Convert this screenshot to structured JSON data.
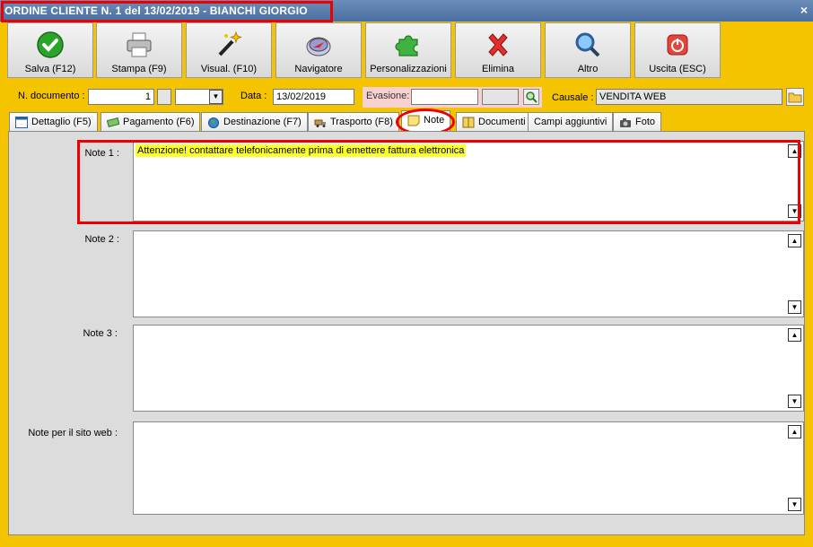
{
  "window": {
    "title": "ORDINE CLIENTE N. 1 del 13/02/2019 - BIANCHI GIORGIO",
    "close_glyph": "×"
  },
  "toolbar": {
    "buttons": [
      {
        "label": "Salva (F12)",
        "icon": "check-icon"
      },
      {
        "label": "Stampa (F9)",
        "icon": "printer-icon"
      },
      {
        "label": "Visual. (F10)",
        "icon": "magic-wand-icon"
      },
      {
        "label": "Navigatore",
        "icon": "compass-icon"
      },
      {
        "label": "Personalizzazioni",
        "icon": "puzzle-icon"
      },
      {
        "label": "Elimina",
        "icon": "delete-x-icon"
      },
      {
        "label": "Altro",
        "icon": "magnifier-icon"
      },
      {
        "label": "Uscita (ESC)",
        "icon": "power-icon"
      }
    ]
  },
  "fields": {
    "n_documento_label": "N. documento :",
    "n_documento_value": "1",
    "data_label": "Data :",
    "data_value": "13/02/2019",
    "evasione_label": "Evasione:",
    "evasione_value": "",
    "causale_label": "Causale :",
    "causale_value": "VENDITA WEB"
  },
  "tabs": [
    {
      "label": "Dettaglio (F5)",
      "icon": "calendar-icon"
    },
    {
      "label": "Pagamento (F6)",
      "icon": "money-icon"
    },
    {
      "label": "Destinazione (F7)",
      "icon": "globe-icon"
    },
    {
      "label": "Trasporto (F8)",
      "icon": "truck-icon"
    },
    {
      "label": "Note",
      "icon": "sticky-note-icon",
      "active": true
    },
    {
      "label": "Documenti",
      "icon": "book-icon"
    },
    {
      "label": "Campi aggiuntivi",
      "icon": ""
    },
    {
      "label": "Foto",
      "icon": "camera-icon"
    }
  ],
  "notes": [
    {
      "label": "Note 1 :",
      "value": "Attenzione! contattare telefonicamente prima di emettere fattura elettronica"
    },
    {
      "label": "Note 2 :",
      "value": ""
    },
    {
      "label": "Note 3 :",
      "value": ""
    },
    {
      "label": "Note per il sito web :",
      "value": ""
    }
  ],
  "colors": {
    "background": "#f5c400",
    "titlebar": "#4a6f9f",
    "highlight": "#ffff2a",
    "annotation": "#e00000"
  }
}
